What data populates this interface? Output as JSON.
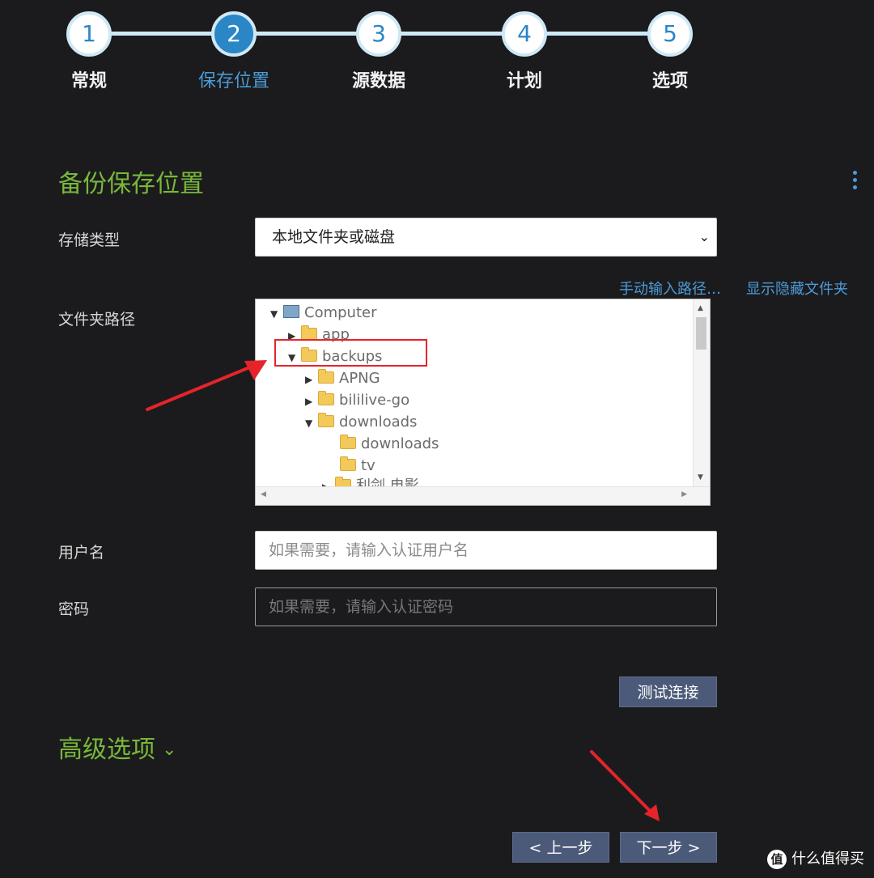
{
  "stepper": {
    "steps": [
      {
        "number": "1",
        "label": "常规"
      },
      {
        "number": "2",
        "label": "保存位置"
      },
      {
        "number": "3",
        "label": "源数据"
      },
      {
        "number": "4",
        "label": "计划"
      },
      {
        "number": "5",
        "label": "选项"
      }
    ],
    "active_step": 2
  },
  "section": {
    "title": "备份保存位置"
  },
  "storage_type": {
    "label": "存储类型",
    "value": "本地文件夹或磁盘"
  },
  "folder_path": {
    "label": "文件夹路径",
    "links": {
      "manual_path": "手动输入路径…",
      "show_hidden": "显示隐藏文件夹"
    },
    "tree": [
      {
        "name": "Computer",
        "expanded": true
      },
      {
        "name": "app",
        "expanded": false
      },
      {
        "name": "backups",
        "expanded": true
      },
      {
        "name": "APNG",
        "expanded": false
      },
      {
        "name": "bililive-go",
        "expanded": false
      },
      {
        "name": "downloads",
        "expanded": true
      },
      {
        "name": "downloads"
      },
      {
        "name": "tv"
      },
      {
        "name": "利剑 电影",
        "expanded": false
      }
    ]
  },
  "username": {
    "label": "用户名",
    "placeholder": "如果需要，请输入认证用户名"
  },
  "password": {
    "label": "密码",
    "placeholder": "如果需要，请输入认证密码"
  },
  "buttons": {
    "test": "测试连接",
    "prev": "< 上一步",
    "next": "下一步 >"
  },
  "advanced": {
    "label": "高级选项"
  },
  "watermark": {
    "icon_text": "值",
    "text": "什么值得买"
  },
  "colors": {
    "accent_green": "#79b83a",
    "accent_blue": "#2b86c6",
    "annotation_red": "#e5242a",
    "background": "#1b1b1d"
  }
}
